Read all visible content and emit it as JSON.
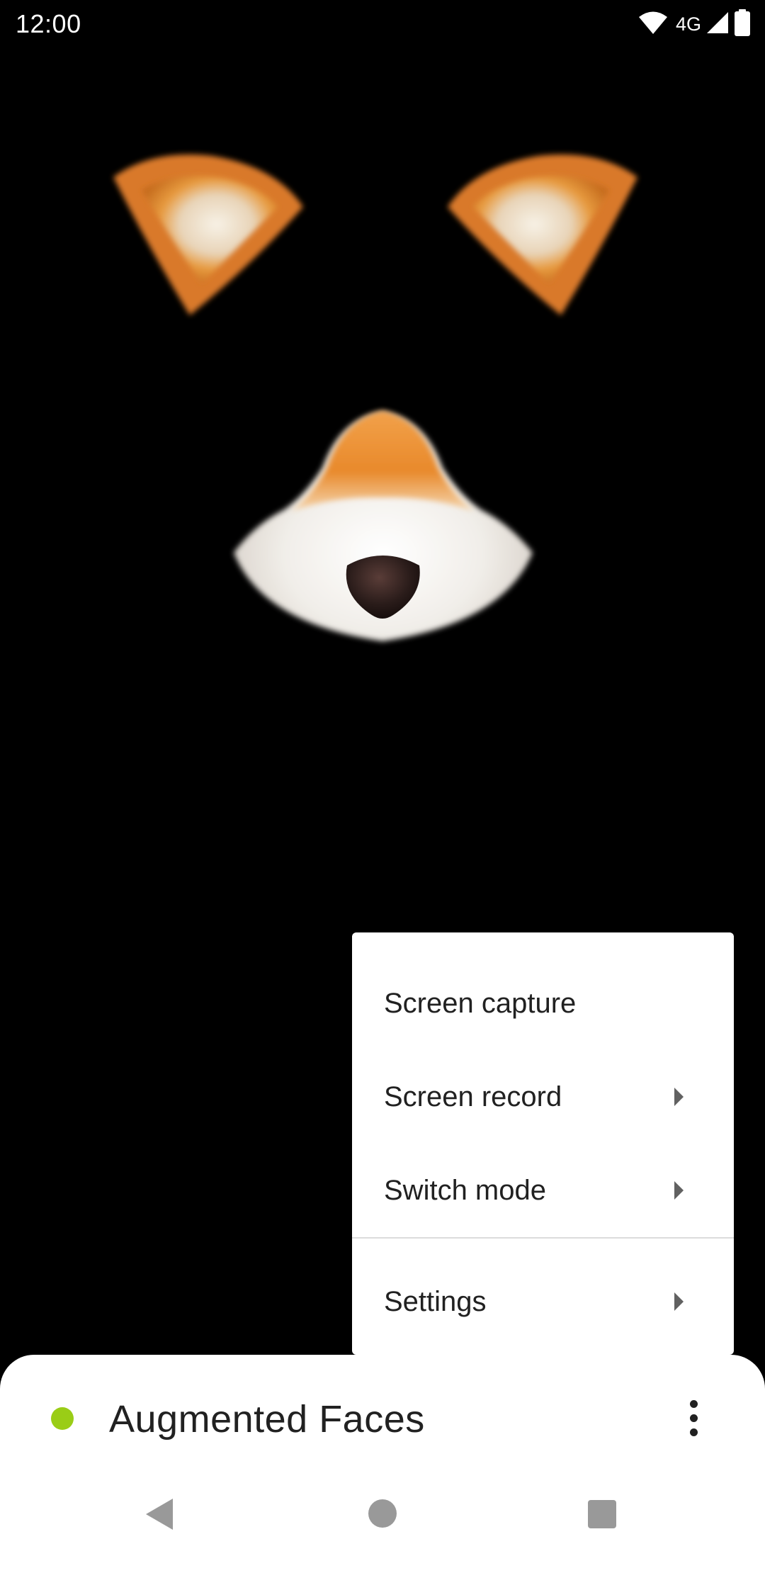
{
  "status_bar": {
    "time": "12:00",
    "network": "4G",
    "icons": [
      "wifi-icon",
      "cell-signal-icon",
      "battery-icon"
    ]
  },
  "camera_view": {
    "filter_parts": [
      "left-ear",
      "right-ear",
      "fox-nose"
    ]
  },
  "menu": {
    "items": [
      {
        "label": "Screen capture",
        "has_submenu": false
      },
      {
        "label": "Screen record",
        "has_submenu": true
      },
      {
        "label": "Switch mode",
        "has_submenu": true
      },
      {
        "label": "Settings",
        "has_submenu": true
      }
    ]
  },
  "bottom_sheet": {
    "title": "Augmented Faces",
    "status_color": "#9acd16",
    "more_icon": "more-vert-icon"
  },
  "nav_bar": {
    "icons": [
      "back-icon",
      "home-icon",
      "recents-icon"
    ]
  },
  "colors": {
    "background": "#000000",
    "fur_orange": "#e8892b",
    "fur_white": "#f4f1ec",
    "nose": "#2a1c1a"
  }
}
